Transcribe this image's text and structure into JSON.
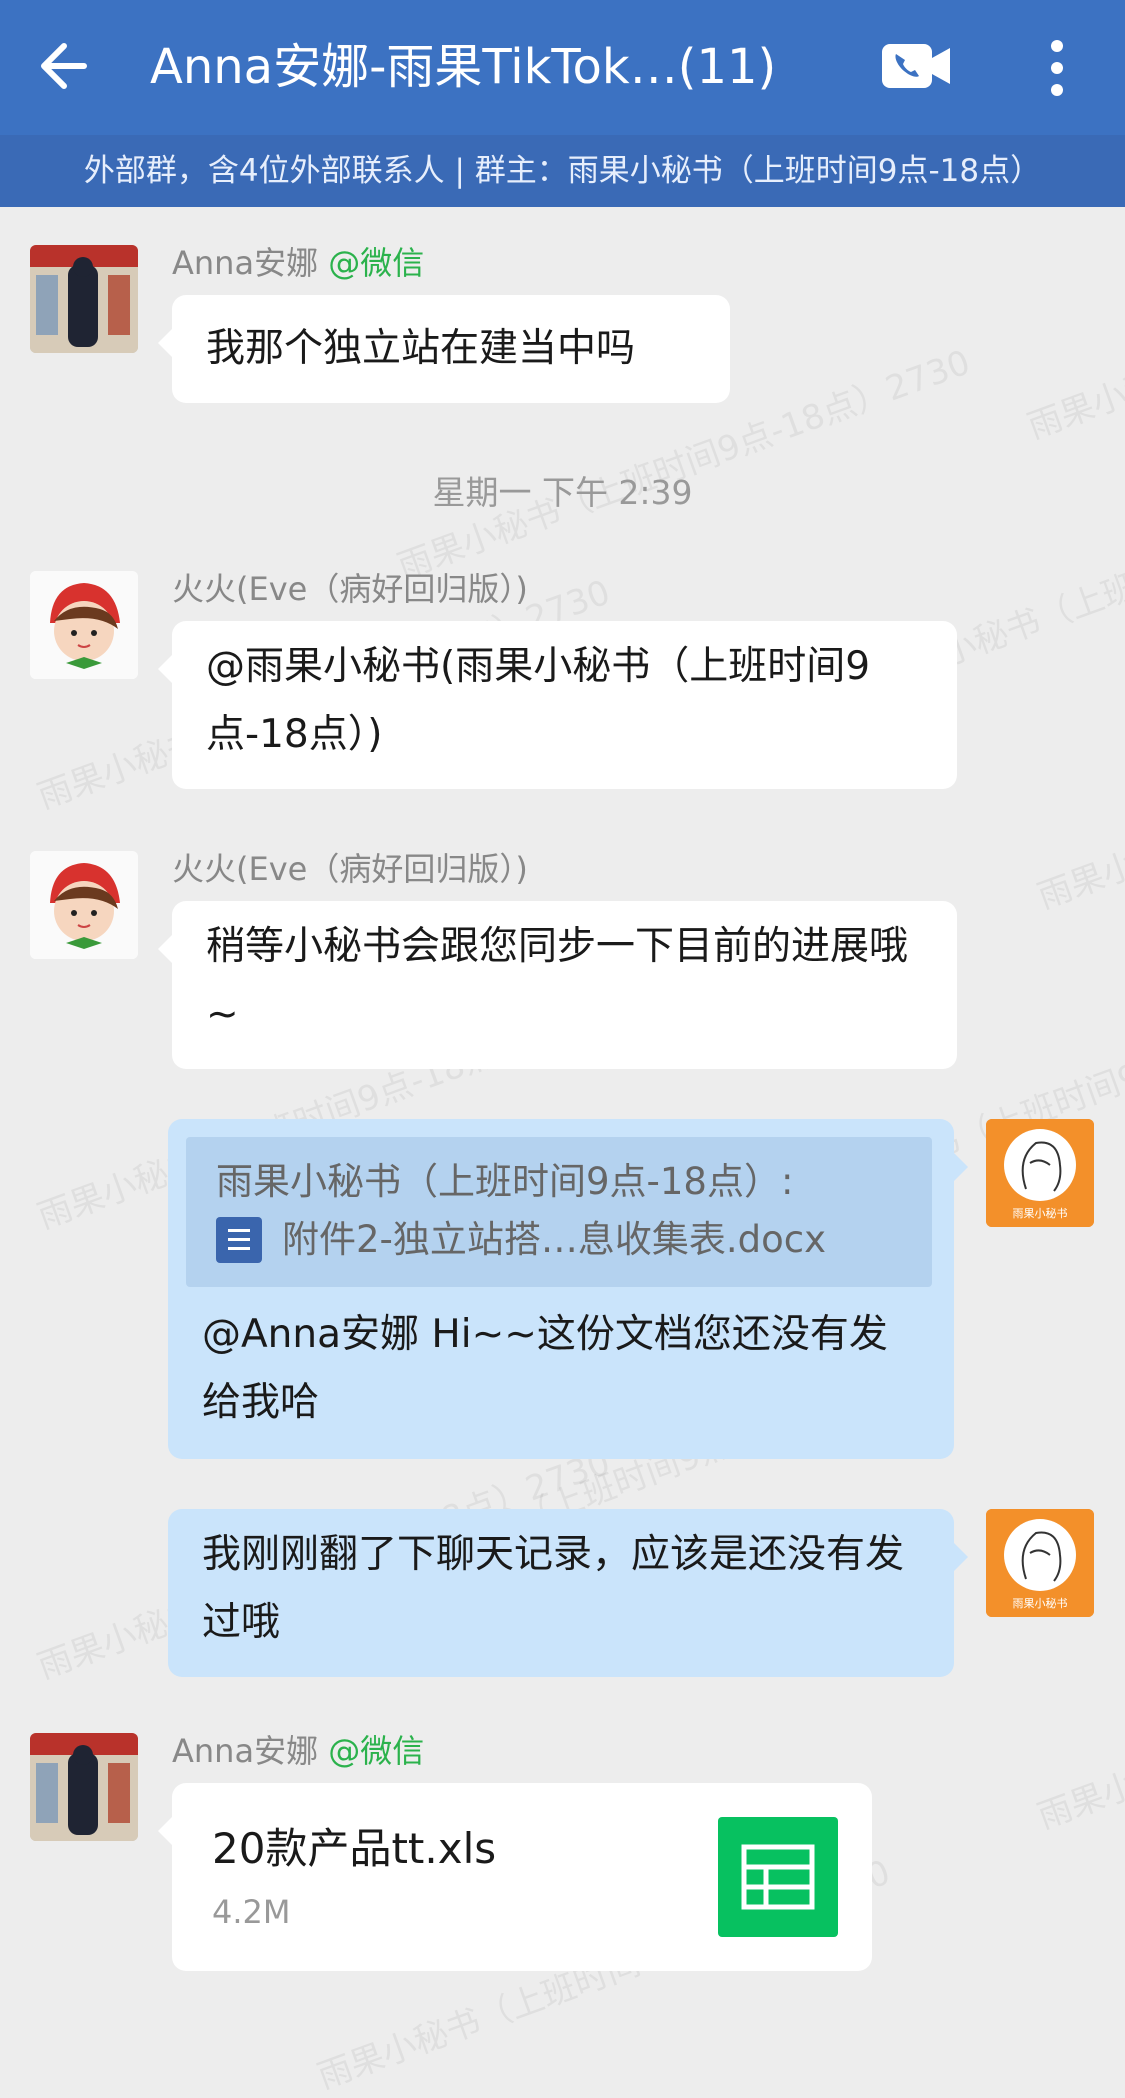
{
  "header": {
    "title": "Anna安娜-雨果TikTok…(11)",
    "subtitle": "外部群，含4位外部联系人 | 群主：雨果小秘书（上班时间9点-18点）",
    "back_icon": "arrow-left-icon",
    "video_icon": "video-call-icon",
    "more_icon": "more-vertical-icon"
  },
  "watermark": "雨果小秘书（上班时间9点-18点）2730",
  "messages": [
    {
      "sender": "Anna安娜",
      "source": "@微信",
      "text": "我那个独立站在建当中吗"
    },
    {
      "timestamp": "星期一 下午 2:39"
    },
    {
      "sender": "火火(Eve（病好回归版）)",
      "text": "@雨果小秘书(雨果小秘书（上班时间9点-18点）)"
    },
    {
      "sender": "火火(Eve（病好回归版）)",
      "text": "稍等小秘书会跟您同步一下目前的进展哦~"
    },
    {
      "quote_author": "雨果小秘书（上班时间9点-18点）:",
      "quote_file": "附件2-独立站搭…息收集表.docx",
      "text": "@Anna安娜  Hi~~这份文档您还没有发给我哈"
    },
    {
      "text": "我刚刚翻了下聊天记录，应该是还没有发过哦"
    },
    {
      "sender": "Anna安娜",
      "source": "@微信",
      "file_name": "20款产品tt.xls",
      "file_size": "4.2M"
    }
  ],
  "avatar_label": "雨果小秘书",
  "colors": {
    "header": "#3c72c2",
    "subheader": "#3a6ab6",
    "bubble_blue": "#cae4fb",
    "wechat_green": "#2bb24c",
    "excel_green": "#07c160"
  }
}
